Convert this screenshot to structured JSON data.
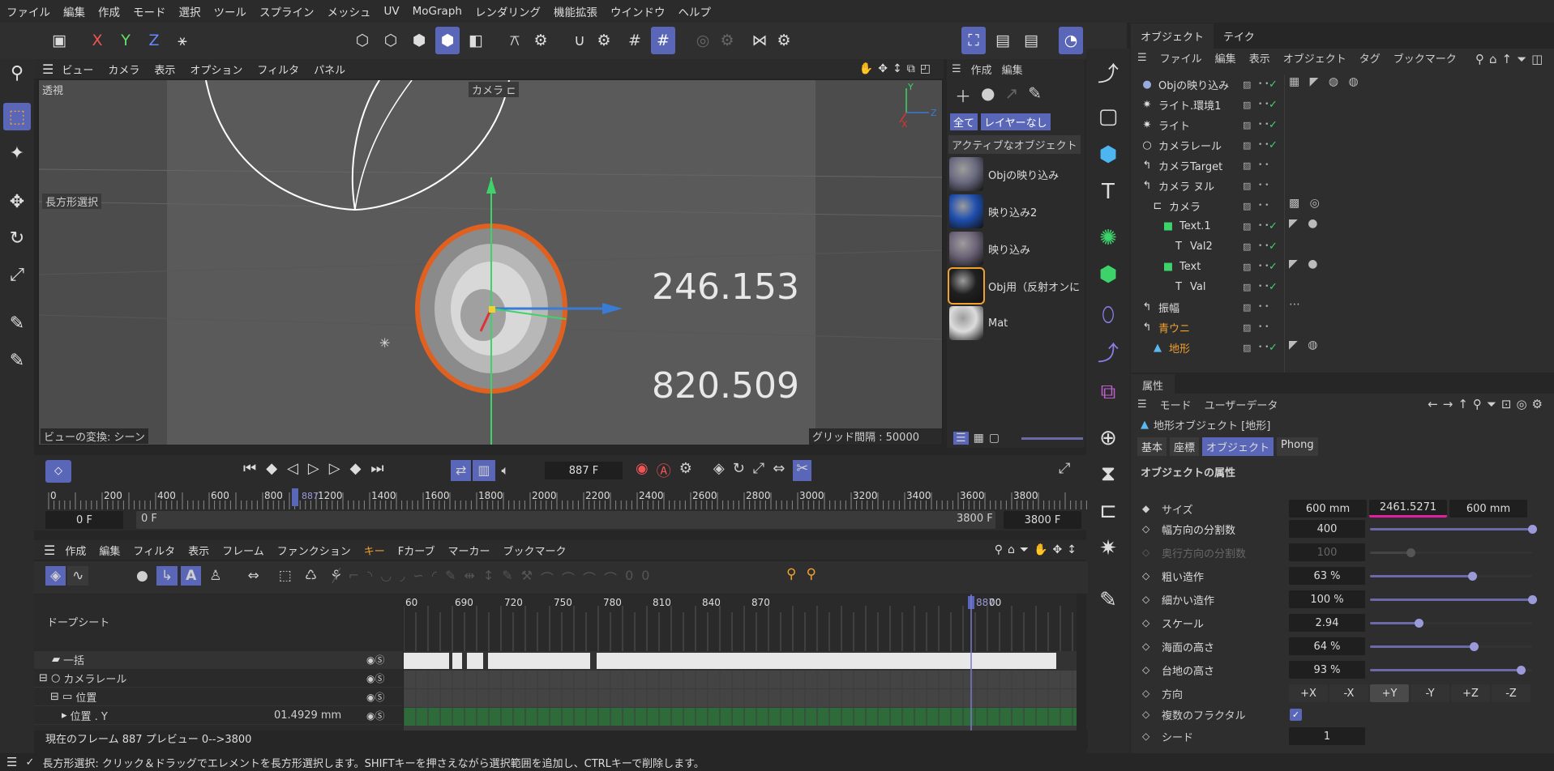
{
  "menu": [
    "ファイル",
    "編集",
    "作成",
    "モード",
    "選択",
    "ツール",
    "スプライン",
    "メッシュ",
    "UV",
    "MoGraph",
    "レンダリング",
    "機能拡張",
    "ウインドウ",
    "ヘルプ"
  ],
  "viewport": {
    "menu": [
      "ビュー",
      "カメラ",
      "表示",
      "オプション",
      "フィルタ",
      "パネル"
    ],
    "label": "透視",
    "camera": "カメラ ⊏",
    "selection_label": "長方形選択",
    "value1": "246.153",
    "value2": "820.509",
    "bottom_left": "ビューの変換: シーン",
    "grid": "グリッド間隔 : 50000 mm",
    "axis_y": "Y",
    "axis_x": "X",
    "axis_z": "Z"
  },
  "materials": {
    "menu": [
      "作成",
      "編集"
    ],
    "all": "全て",
    "layer": "レイヤーなし",
    "active": "アクティブなオブジェクト",
    "items": [
      {
        "name": "Objの映り込み",
        "color": "#6a6a80"
      },
      {
        "name": "映り込み2",
        "color": "#1f4fb0"
      },
      {
        "name": "映り込み",
        "color": "#6c6478"
      },
      {
        "name": "Obj用（反射オンに",
        "color": "#202020"
      },
      {
        "name": "Mat",
        "color": "#dcdcdc"
      }
    ]
  },
  "objects": {
    "tabs": [
      "オブジェクト",
      "テイク"
    ],
    "menu": [
      "ファイル",
      "編集",
      "表示",
      "オブジェクト",
      "タグ",
      "ブックマーク"
    ],
    "rows": [
      {
        "name": "Objの映り込み",
        "indent": 0,
        "icon": "●",
        "check": true,
        "color": "#ddd"
      },
      {
        "name": "ライト.環境1",
        "indent": 0,
        "icon": "✷",
        "check": true,
        "color": "#ddd"
      },
      {
        "name": "ライト",
        "indent": 0,
        "icon": "✷",
        "check": true,
        "color": "#ddd"
      },
      {
        "name": "カメラレール",
        "indent": 0,
        "icon": "○",
        "check": true,
        "color": "#ddd"
      },
      {
        "name": "カメラTarget",
        "indent": 0,
        "icon": "↰",
        "check": false,
        "color": "#ddd"
      },
      {
        "name": "カメラ ヌル",
        "indent": 0,
        "icon": "↰",
        "check": false,
        "color": "#ddd"
      },
      {
        "name": "カメラ",
        "indent": 1,
        "icon": "⊏",
        "check": false,
        "color": "#ddd"
      },
      {
        "name": "Text.1",
        "indent": 2,
        "icon": "■",
        "check": true,
        "color": "#ddd"
      },
      {
        "name": "Val2",
        "indent": 3,
        "icon": "T",
        "check": true,
        "color": "#ddd"
      },
      {
        "name": "Text",
        "indent": 2,
        "icon": "■",
        "check": true,
        "color": "#ddd"
      },
      {
        "name": "Val",
        "indent": 3,
        "icon": "T",
        "check": true,
        "color": "#ddd"
      },
      {
        "name": "振幅",
        "indent": 0,
        "icon": "↰",
        "check": false,
        "color": "#ddd"
      },
      {
        "name": "青ウニ",
        "indent": 0,
        "icon": "↰",
        "check": false,
        "color": "#f0a030"
      },
      {
        "name": "地形",
        "indent": 1,
        "icon": "▲",
        "check": true,
        "color": "#f0a030"
      }
    ]
  },
  "attributes": {
    "tab": "属性",
    "menu": [
      "モード",
      "ユーザーデータ"
    ],
    "object_title": "地形オブジェクト [地形]",
    "subtabs": [
      "基本",
      "座標",
      "オブジェクト",
      "Phong"
    ],
    "section": "オブジェクトの属性",
    "size_label": "サイズ",
    "size": [
      "600 mm",
      "2461.5271",
      "600 mm"
    ],
    "params": [
      {
        "label": "幅方向の分割数",
        "value": "400",
        "level": 1.0,
        "dim": false
      },
      {
        "label": "奥行方向の分割数",
        "value": "100",
        "level": 0.25,
        "dim": true
      },
      {
        "label": "粗い造作",
        "value": "63 %",
        "level": 0.63,
        "dim": false
      },
      {
        "label": "細かい造作",
        "value": "100 %",
        "level": 1.0,
        "dim": false
      },
      {
        "label": "スケール",
        "value": "2.94",
        "level": 0.3,
        "dim": false
      },
      {
        "label": "海面の高さ",
        "value": "64 %",
        "level": 0.64,
        "dim": false
      },
      {
        "label": "台地の高さ",
        "value": "93 %",
        "level": 0.93,
        "dim": false
      }
    ],
    "direction_label": "方向",
    "directions": [
      "+X",
      "-X",
      "+Y",
      "-Y",
      "+Z",
      "-Z"
    ],
    "fractal_label": "複数のフラクタル",
    "seed_label": "シード",
    "seed": "1"
  },
  "timeline": {
    "frame": "887 F",
    "ruler": [
      "0",
      "200",
      "400",
      "600",
      "800",
      "887",
      "1200",
      "1400",
      "1600",
      "1800",
      "2000",
      "2200",
      "2400",
      "2600",
      "2800",
      "3000",
      "3200",
      "3400",
      "3600",
      "3800"
    ],
    "range_start": "0 F",
    "range_start2": "0 F",
    "range_end": "3800 F",
    "range_end2": "3800 F"
  },
  "dopesheet": {
    "menu": [
      "作成",
      "編集",
      "フィルタ",
      "表示",
      "フレーム",
      "ファンクション",
      "キー",
      "Fカーブ",
      "マーカー",
      "ブックマーク"
    ],
    "title": "ドープシート",
    "ruler": [
      "60",
      "690",
      "720",
      "750",
      "780",
      "810",
      "840",
      "870",
      "887",
      "00"
    ],
    "tracks": [
      {
        "name": "一括",
        "value": ""
      },
      {
        "name": "カメラレール",
        "value": ""
      },
      {
        "name": "位置",
        "value": ""
      },
      {
        "name": "位置 . Y",
        "value": "01.4929 mm"
      }
    ],
    "status": "現在のフレーム  887  プレビュー  0-->3800"
  },
  "statusbar": "長方形選択: クリック＆ドラッグでエレメントを長方形選択します。SHIFTキーを押さえながら選択範囲を追加し、CTRLキーで削除します。"
}
